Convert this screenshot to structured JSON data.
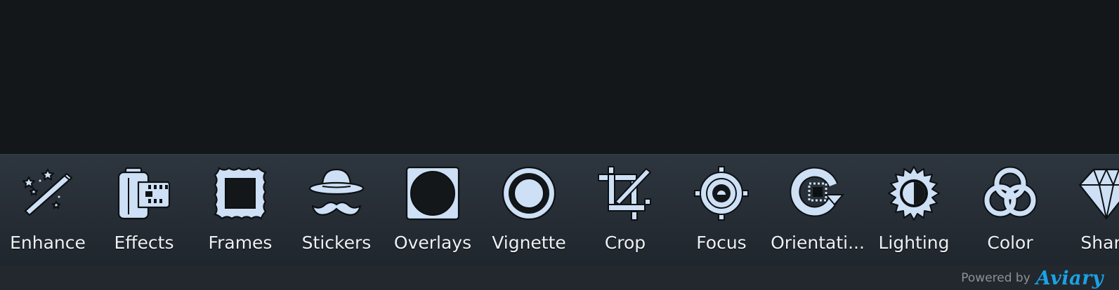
{
  "toolbar": {
    "tools": [
      {
        "label": "Enhance",
        "icon": "magic-wand-icon"
      },
      {
        "label": "Effects",
        "icon": "film-roll-icon"
      },
      {
        "label": "Frames",
        "icon": "frame-icon"
      },
      {
        "label": "Stickers",
        "icon": "hat-mustache-icon"
      },
      {
        "label": "Overlays",
        "icon": "overlay-icon"
      },
      {
        "label": "Vignette",
        "icon": "vignette-icon"
      },
      {
        "label": "Crop",
        "icon": "crop-icon"
      },
      {
        "label": "Focus",
        "icon": "focus-icon"
      },
      {
        "label": "Orientati...",
        "icon": "rotate-icon"
      },
      {
        "label": "Lighting",
        "icon": "sun-icon"
      },
      {
        "label": "Color",
        "icon": "color-circles-icon"
      },
      {
        "label": "Sharp",
        "icon": "diamond-icon"
      }
    ]
  },
  "footer": {
    "powered_by": "Powered by",
    "brand": "Aviary"
  },
  "colors": {
    "icon_fill": "#cde0f5",
    "label": "#edf1f5",
    "brand": "#1aa2e6",
    "canvas": "#141719"
  }
}
